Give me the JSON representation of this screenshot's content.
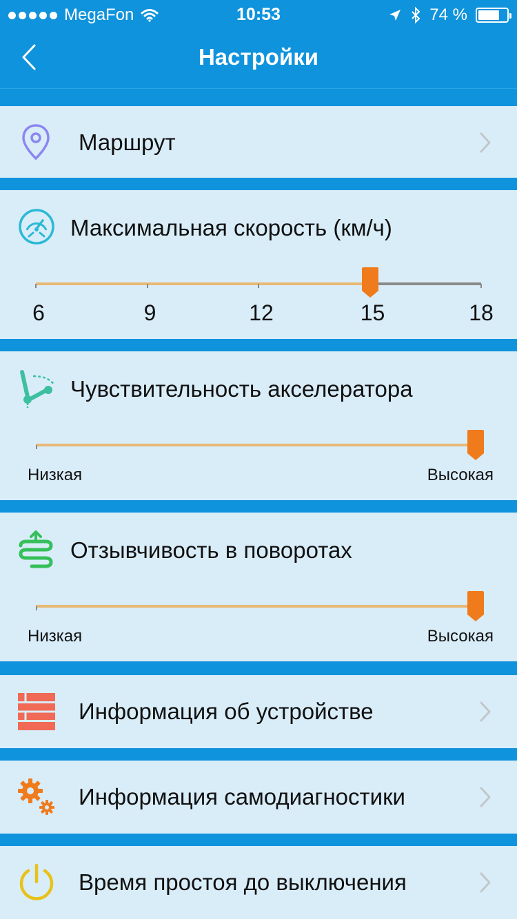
{
  "status_bar": {
    "carrier": "MegaFon",
    "time": "10:53",
    "battery_text": "74 %",
    "battery_level": 0.74
  },
  "nav": {
    "title": "Настройки",
    "back_icon": "chevron-left-icon"
  },
  "settings": {
    "route": {
      "label": "Маршрут",
      "icon": "location-pin-icon"
    },
    "max_speed": {
      "label": "Максимальная скорость (км/ч)",
      "icon": "speedometer-icon",
      "ticks": [
        "6",
        "9",
        "12",
        "15",
        "18"
      ],
      "min": 6,
      "max": 18,
      "value": 15
    },
    "accelerator": {
      "label": "Чувствительность акселератора",
      "icon": "pedal-icon",
      "low_label": "Низкая",
      "high_label": "Высокая",
      "value": 1.0
    },
    "turning": {
      "label": "Отзывчивость в поворотах",
      "icon": "curved-road-icon",
      "low_label": "Низкая",
      "high_label": "Высокая",
      "value": 1.0
    },
    "device_info": {
      "label": "Информация об устройстве",
      "icon": "grid-list-icon"
    },
    "self_diagnostics": {
      "label": "Информация самодиагностики",
      "icon": "gears-icon"
    },
    "idle_time": {
      "label": "Время простоя до выключения",
      "icon": "power-icon"
    }
  },
  "colors": {
    "primary": "#0f93dc",
    "card_bg": "#d9edf9",
    "slider_active": "#e8b875",
    "slider_inactive": "#8a8a8a",
    "thumb": "#f07b1c",
    "chevron": "#c2c6ca"
  }
}
